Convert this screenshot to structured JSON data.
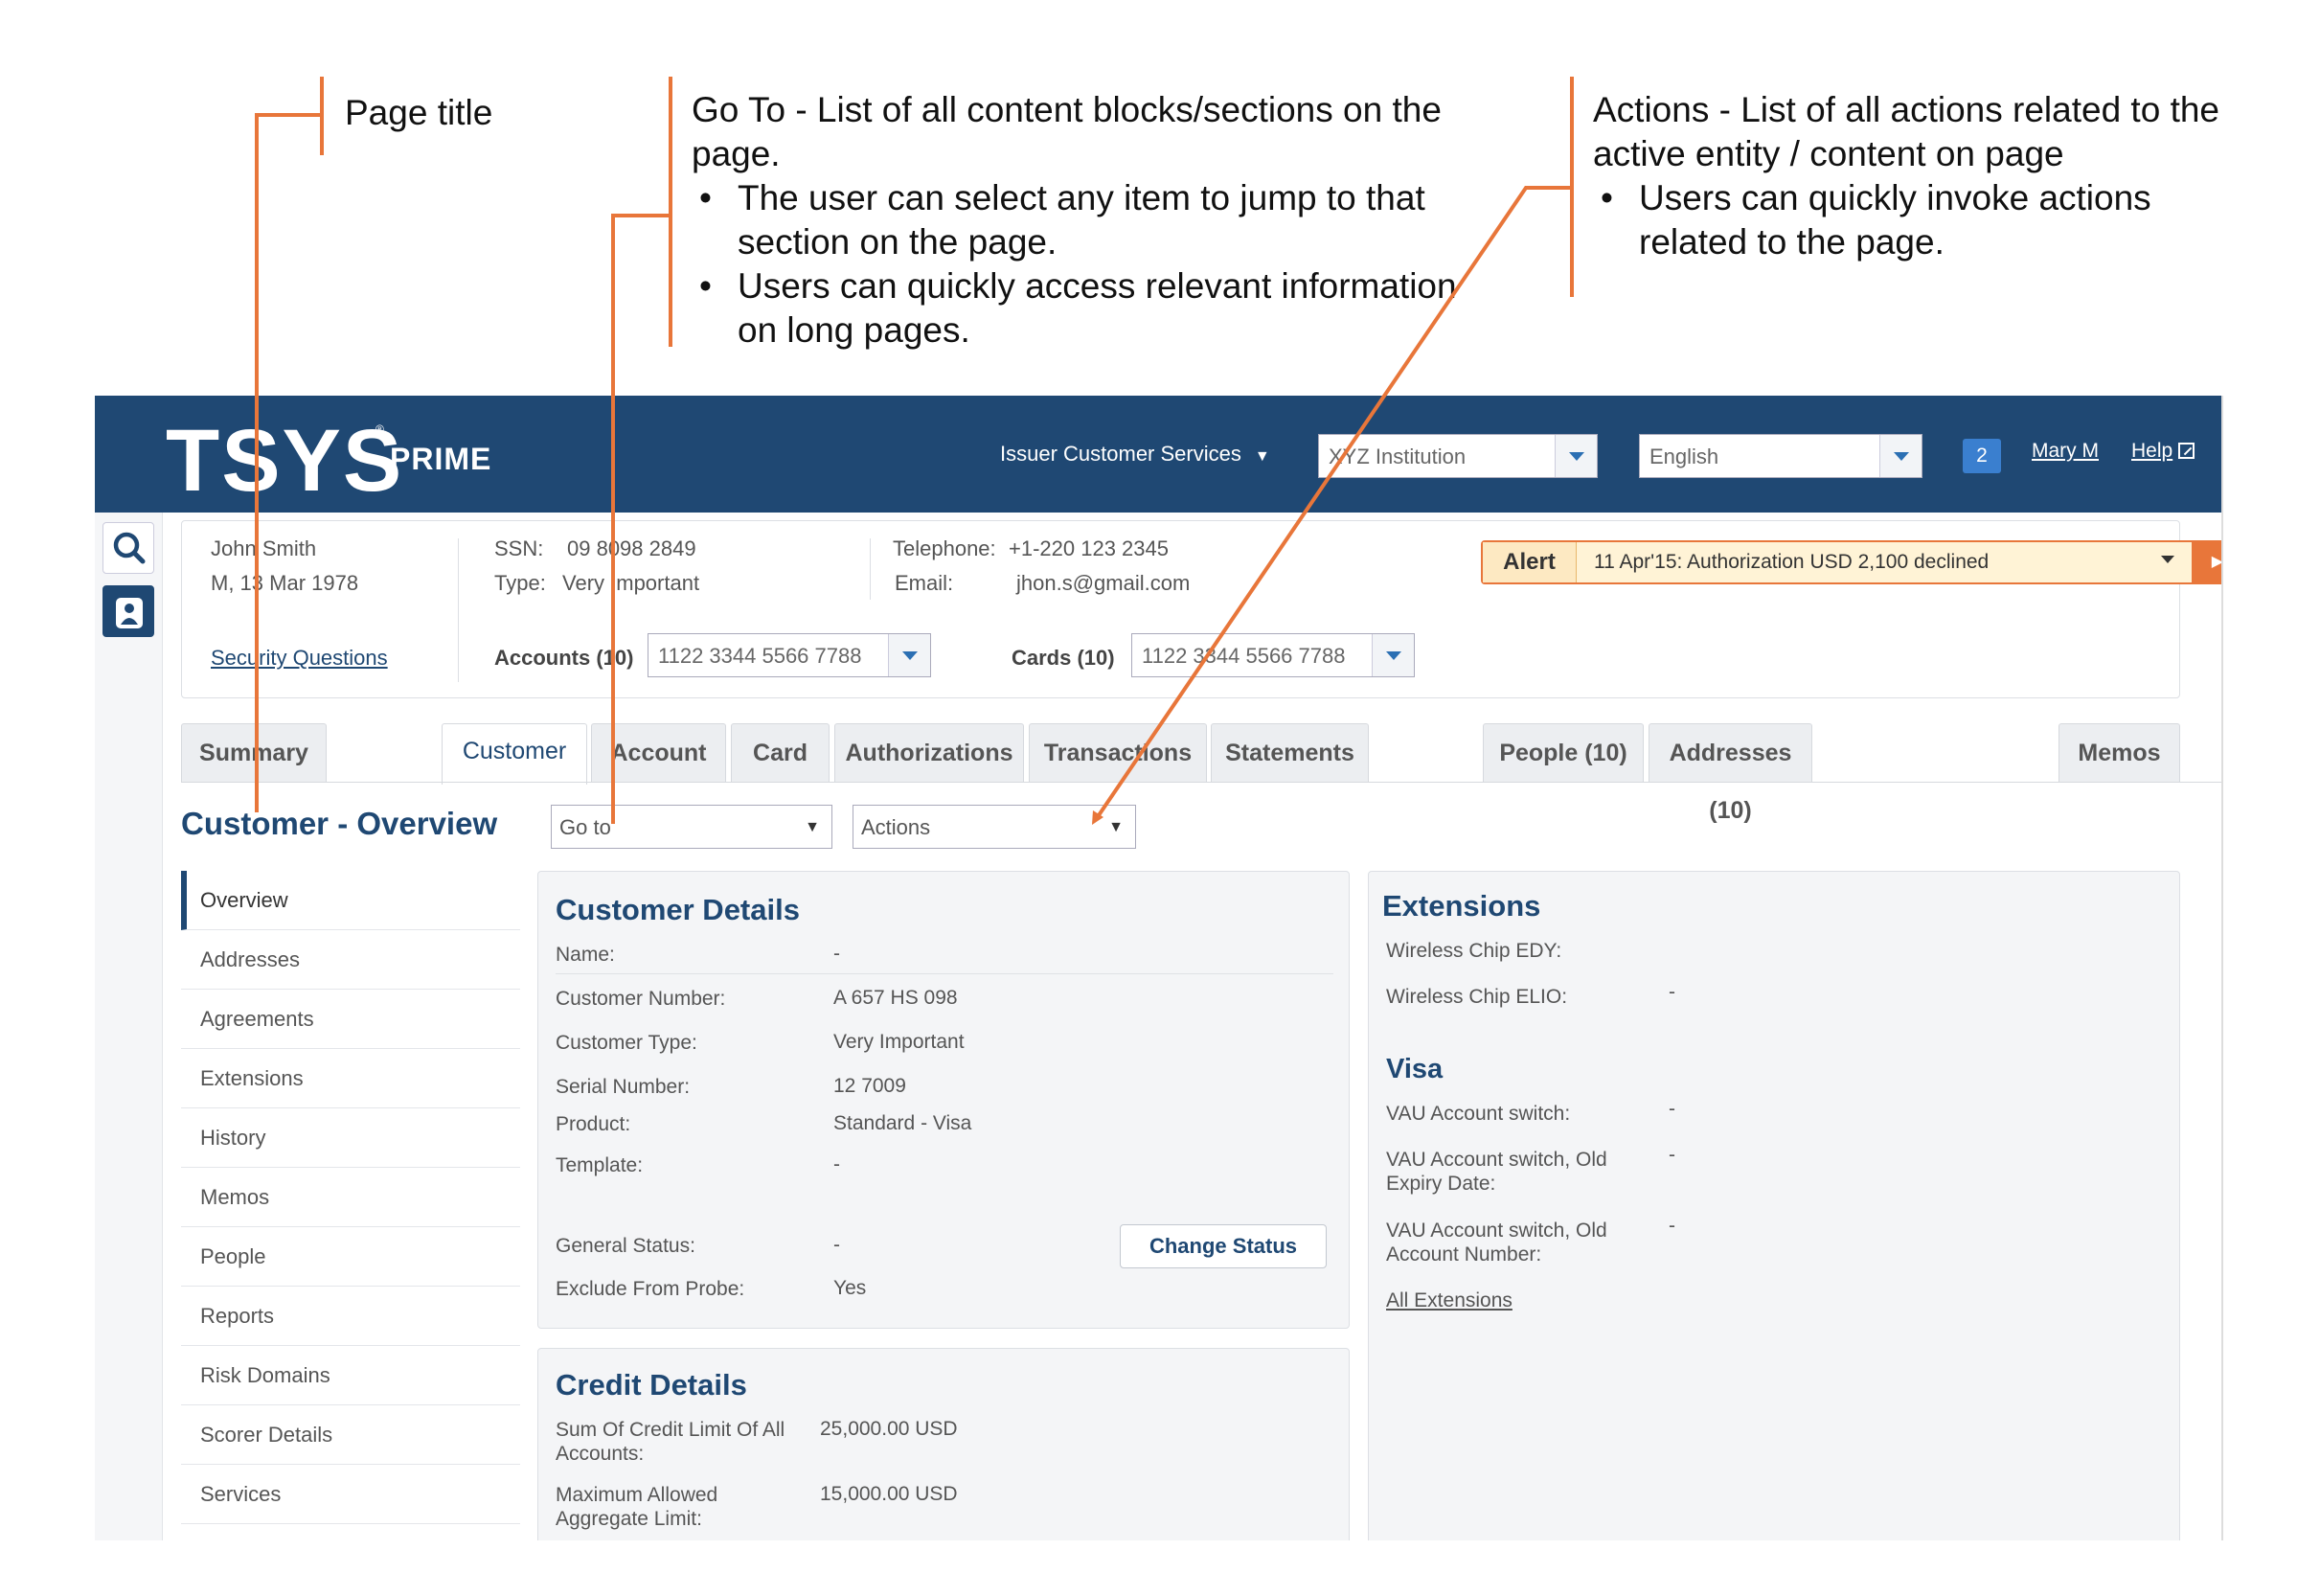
{
  "annotations": {
    "page_title": "Page title",
    "goto": {
      "title": "Go To  - List of all content blocks/sections on the page.",
      "bullets": [
        "The user can select any item to jump to that section on the page.",
        "Users can quickly access relevant information on long pages."
      ]
    },
    "actions": {
      "title": "Actions - List of all actions related to the active entity / content on page",
      "bullets": [
        "Users can quickly invoke actions related to the page."
      ]
    }
  },
  "header": {
    "logo": "TSYS",
    "logo_reg": "®",
    "product": "PRIME",
    "menu_label": "Issuer Customer Services",
    "institution": "XYZ Institution",
    "language": "English",
    "notifications": "2",
    "user": "Mary M",
    "help": "Help"
  },
  "customer": {
    "name": "John Smith",
    "sex_dob": "M, 13 Mar 1978",
    "security_link": "Security Questions",
    "ssn_label": "SSN:",
    "ssn": "09 8098 2849",
    "type_label": "Type:",
    "type": "Very Important",
    "phone_label": "Telephone:",
    "phone": "+1-220 123 2345",
    "email_label": "Email:",
    "email": "jhon.s@gmail.com",
    "accounts_label": "Accounts (10)",
    "accounts_value": "1122 3344 5566 7788",
    "cards_label": "Cards (10)",
    "cards_value": "1122 3344 5566 7788",
    "alert_label": "Alert",
    "alert_text": "11 Apr'15: Authorization USD 2,100 declined"
  },
  "tabs": [
    "Summary",
    "Customer",
    "Account",
    "Card",
    "Authorizations",
    "Transactions",
    "Statements",
    "People (10)",
    "Addresses (10)",
    "Memos"
  ],
  "page": {
    "title": "Customer - Overview",
    "goto_label": "Go to",
    "actions_label": "Actions"
  },
  "subnav": [
    "Overview",
    "Addresses",
    "Agreements",
    "Extensions",
    "History",
    "Memos",
    "People",
    "Reports",
    "Risk Domains",
    "Scorer Details",
    "Services"
  ],
  "customer_details": {
    "title": "Customer Details",
    "fields": [
      {
        "label": "Name:",
        "value": "-"
      },
      {
        "label": "Customer Number:",
        "value": "A 657 HS 098"
      },
      {
        "label": "Customer Type:",
        "value": "Very Important"
      },
      {
        "label": "Serial Number:",
        "value": "12 7009"
      },
      {
        "label": "Product:",
        "value": "Standard - Visa"
      },
      {
        "label": "Template:",
        "value": "-"
      },
      {
        "label": "General Status:",
        "value": "-"
      },
      {
        "label": "Exclude From Probe:",
        "value": "Yes"
      }
    ],
    "change_status": "Change Status"
  },
  "credit_details": {
    "title": "Credit Details",
    "fields": [
      {
        "label": "Sum Of Credit Limit  Of All Accounts:",
        "value": "25,000.00  USD"
      },
      {
        "label": "Maximum Allowed Aggregate Limit:",
        "value": "15,000.00  USD"
      }
    ]
  },
  "extensions": {
    "title": "Extensions",
    "fields": [
      {
        "label": "Wireless Chip EDY:",
        "value": ""
      },
      {
        "label": "Wireless Chip ELIO:",
        "value": "-"
      }
    ],
    "visa_title": "Visa",
    "visa_fields": [
      {
        "label": "VAU Account switch:",
        "value": "-"
      },
      {
        "label": "VAU Account switch, Old Expiry Date:",
        "value": "-"
      },
      {
        "label": "VAU Account switch, Old Account Number:",
        "value": "-"
      }
    ],
    "all_link": "All Extensions"
  },
  "colors": {
    "header": "#1f4873",
    "accent": "#e8763a",
    "link": "#1f4873"
  }
}
